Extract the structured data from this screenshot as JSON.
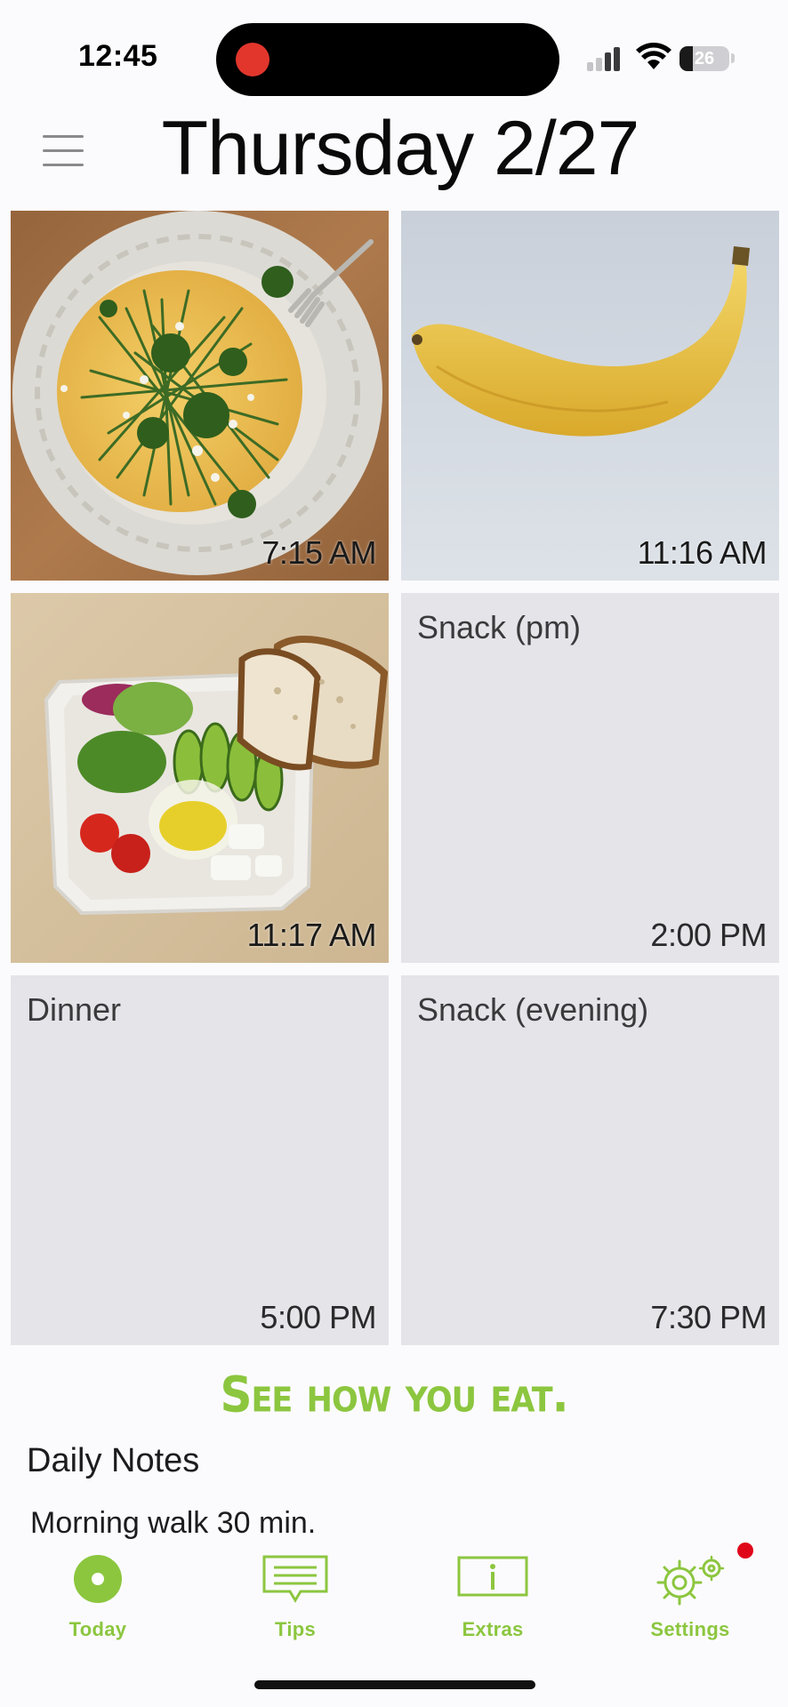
{
  "status_bar": {
    "time": "12:45",
    "battery_level": "26",
    "battery_fraction": 0.26
  },
  "header": {
    "title": "Thursday 2/27",
    "menu_icon": "hamburger-menu-icon"
  },
  "meals": [
    {
      "label": "",
      "time": "7:15 AM",
      "photo": "omelet-with-herbs",
      "has_photo": true
    },
    {
      "label": "",
      "time": "11:16 AM",
      "photo": "banana",
      "has_photo": true
    },
    {
      "label": "",
      "time": "11:17 AM",
      "photo": "salad-with-bread",
      "has_photo": true
    },
    {
      "label": "Snack (pm)",
      "time": "2:00 PM",
      "has_photo": false
    },
    {
      "label": "Dinner",
      "time": "5:00 PM",
      "has_photo": false
    },
    {
      "label": "Snack (evening)",
      "time": "7:30 PM",
      "has_photo": false
    }
  ],
  "slogan": "See how you eat.",
  "notes": {
    "title": "Daily Notes",
    "text": "Morning walk 30 min."
  },
  "tabs": [
    {
      "label": "Today",
      "icon": "today-circle-icon",
      "selected": true
    },
    {
      "label": "Tips",
      "icon": "tips-speech-bubble-icon"
    },
    {
      "label": "Extras",
      "icon": "extras-info-icon"
    },
    {
      "label": "Settings",
      "icon": "settings-gears-icon",
      "badge": true
    }
  ],
  "colors": {
    "accent": "#8cc63f",
    "tile_bg": "#e5e4e8",
    "badge": "#e0061a",
    "recording": "#e2362d"
  }
}
